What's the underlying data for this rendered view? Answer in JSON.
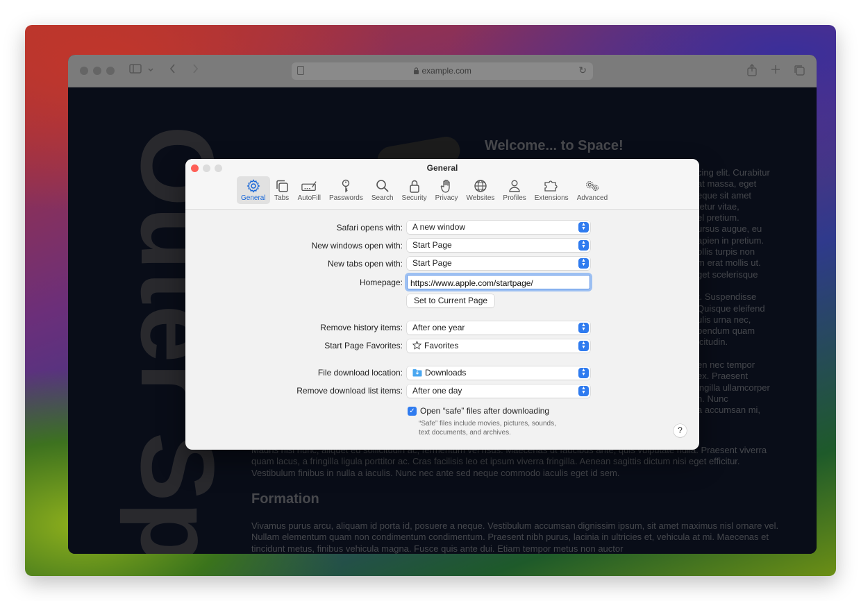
{
  "browser": {
    "url": "example.com"
  },
  "webpage": {
    "vertical_title": "Outer Space",
    "heading": "Welcome... to Space!",
    "right_column_lines": [
      "cing elit. Curabitur",
      "at massa, eget",
      "eque sit amet",
      "tetur vitae,",
      "el pretium.",
      "ursus augue, eu",
      "apien in pretium.",
      "ollis turpis non",
      "m erat mollis ut.",
      "get scelerisque",
      "",
      "t. Suspendisse",
      "Quisque eleifend",
      "ulis urna nec,",
      "bendum quam",
      "icitudin.",
      "",
      "en nec tempor",
      "ex. Praesent",
      "ingilla ullamcorper",
      "n. Nunc",
      "a accumsan mi,"
    ],
    "paragraph1": "Mauris nisi nunc, aliquet eu sollicitudin ac, fermentum vel risus. Maecenas ut faucibus ante, quis vulputate nulla. Praesent viverra quam lacus, a fringilla ligula porttitor ac. Cras facilisis leo et ipsum viverra fringilla. Aenean sagittis dictum nisi eget efficitur. Vestibulum finibus in nulla a iaculis. Nunc nec ante sed neque commodo iaculis eget id sem.",
    "heading2": "Formation",
    "paragraph2": "Vivamus purus arcu, aliquam id porta id, posuere a neque. Vestibulum accumsan dignissim ipsum, sit amet maximus nisl ornare vel. Nullam elementum quam non condimentum condimentum. Praesent nibh purus, lacinia in ultricies et, vehicula at mi. Maecenas et tincidunt metus, finibus vehicula magna. Fusce quis ante dui. Etiam tempor metus non auctor"
  },
  "dialog": {
    "title": "General",
    "tabs": [
      {
        "label": "General",
        "icon": "gear-icon",
        "active": true
      },
      {
        "label": "Tabs",
        "icon": "tabs-icon",
        "active": false
      },
      {
        "label": "AutoFill",
        "icon": "autofill-icon",
        "active": false
      },
      {
        "label": "Passwords",
        "icon": "key-icon",
        "active": false
      },
      {
        "label": "Search",
        "icon": "magnifier-icon",
        "active": false
      },
      {
        "label": "Security",
        "icon": "lock-icon",
        "active": false
      },
      {
        "label": "Privacy",
        "icon": "hand-icon",
        "active": false
      },
      {
        "label": "Websites",
        "icon": "globe-icon",
        "active": false
      },
      {
        "label": "Profiles",
        "icon": "person-icon",
        "active": false
      },
      {
        "label": "Extensions",
        "icon": "puzzle-icon",
        "active": false
      },
      {
        "label": "Advanced",
        "icon": "gears-icon",
        "active": false
      }
    ],
    "fields": {
      "safari_opens_label": "Safari opens with:",
      "safari_opens_value": "A new window",
      "new_windows_label": "New windows open with:",
      "new_windows_value": "Start Page",
      "new_tabs_label": "New tabs open with:",
      "new_tabs_value": "Start Page",
      "homepage_label": "Homepage:",
      "homepage_value": "https://www.apple.com/startpage/",
      "set_current_button": "Set to Current Page",
      "remove_history_label": "Remove history items:",
      "remove_history_value": "After one year",
      "favorites_label": "Start Page Favorites:",
      "favorites_value": "Favorites",
      "download_location_label": "File download location:",
      "download_location_value": "Downloads",
      "remove_downloads_label": "Remove download list items:",
      "remove_downloads_value": "After one day",
      "open_safe_label": "Open “safe” files after downloading",
      "open_safe_checked": true,
      "safe_hint_line1": "“Safe” files include movies, pictures, sounds,",
      "safe_hint_line2": "text documents, and archives.",
      "help_label": "?"
    },
    "accent_color": "#2f7bef"
  }
}
